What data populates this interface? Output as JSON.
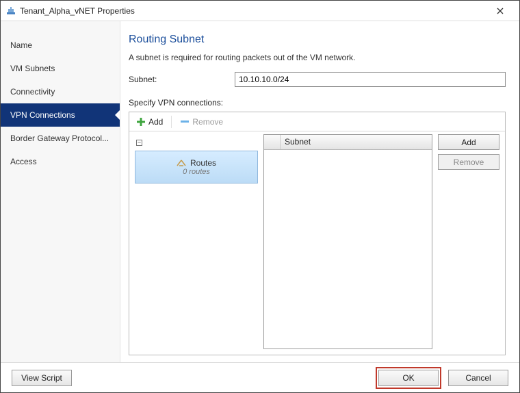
{
  "window": {
    "title": "Tenant_Alpha_vNET Properties"
  },
  "sidebar": {
    "items": [
      {
        "label": "Name"
      },
      {
        "label": "VM Subnets"
      },
      {
        "label": "Connectivity"
      },
      {
        "label": "VPN Connections"
      },
      {
        "label": "Border Gateway Protocol..."
      },
      {
        "label": "Access"
      }
    ]
  },
  "main": {
    "heading": "Routing Subnet",
    "description": "A subnet is required for routing packets out of the VM network.",
    "subnet_label": "Subnet:",
    "subnet_value": "10.10.10.0/24",
    "specify_label": "Specify VPN connections:",
    "toolbar": {
      "add": "Add",
      "remove": "Remove"
    },
    "tree": {
      "routes_label": "Routes",
      "routes_count": "0 routes"
    },
    "grid": {
      "column": "Subnet"
    },
    "buttons": {
      "add": "Add",
      "remove": "Remove"
    }
  },
  "footer": {
    "view_script": "View Script",
    "ok": "OK",
    "cancel": "Cancel"
  }
}
